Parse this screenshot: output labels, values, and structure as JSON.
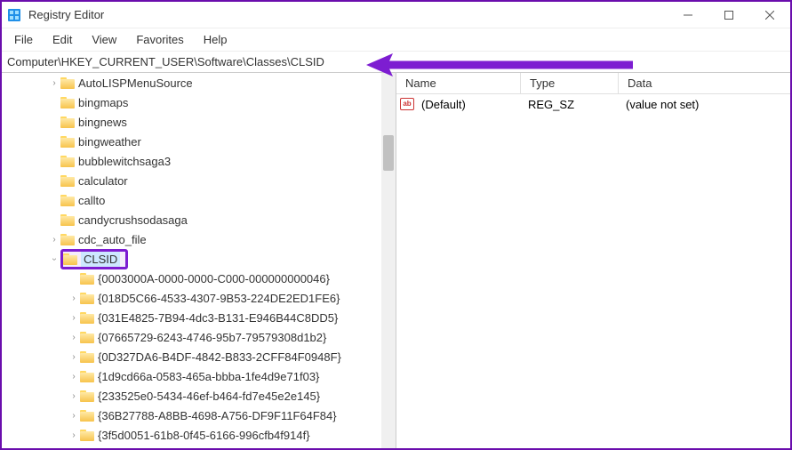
{
  "window": {
    "title": "Registry Editor"
  },
  "menu": {
    "file": "File",
    "edit": "Edit",
    "view": "View",
    "favorites": "Favorites",
    "help": "Help"
  },
  "address": "Computer\\HKEY_CURRENT_USER\\Software\\Classes\\CLSID",
  "tree": {
    "level1": [
      {
        "label": "AutoLISPMenuSource",
        "exp": true
      },
      {
        "label": "bingmaps",
        "exp": false
      },
      {
        "label": "bingnews",
        "exp": false
      },
      {
        "label": "bingweather",
        "exp": false
      },
      {
        "label": "bubblewitchsaga3",
        "exp": false
      },
      {
        "label": "calculator",
        "exp": false
      },
      {
        "label": "callto",
        "exp": false
      },
      {
        "label": "candycrushsodasaga",
        "exp": false
      },
      {
        "label": "cdc_auto_file",
        "exp": true
      }
    ],
    "selected": "CLSID",
    "children": [
      "{0003000A-0000-0000-C000-000000000046}",
      "{018D5C66-4533-4307-9B53-224DE2ED1FE6}",
      "{031E4825-7B94-4dc3-B131-E946B44C8DD5}",
      "{07665729-6243-4746-95b7-79579308d1b2}",
      "{0D327DA6-B4DF-4842-B833-2CFF84F0948F}",
      "{1d9cd66a-0583-465a-bbba-1fe4d9e71f03}",
      "{233525e0-5434-46ef-b464-fd7e45e2e145}",
      "{36B27788-A8BB-4698-A756-DF9F11F64F84}",
      "{3f5d0051-61b8-0f45-6166-996cfb4f914f}"
    ]
  },
  "list": {
    "cols": {
      "name": "Name",
      "type": "Type",
      "data": "Data"
    },
    "row": {
      "name": "(Default)",
      "type": "REG_SZ",
      "data": "(value not set)"
    }
  }
}
